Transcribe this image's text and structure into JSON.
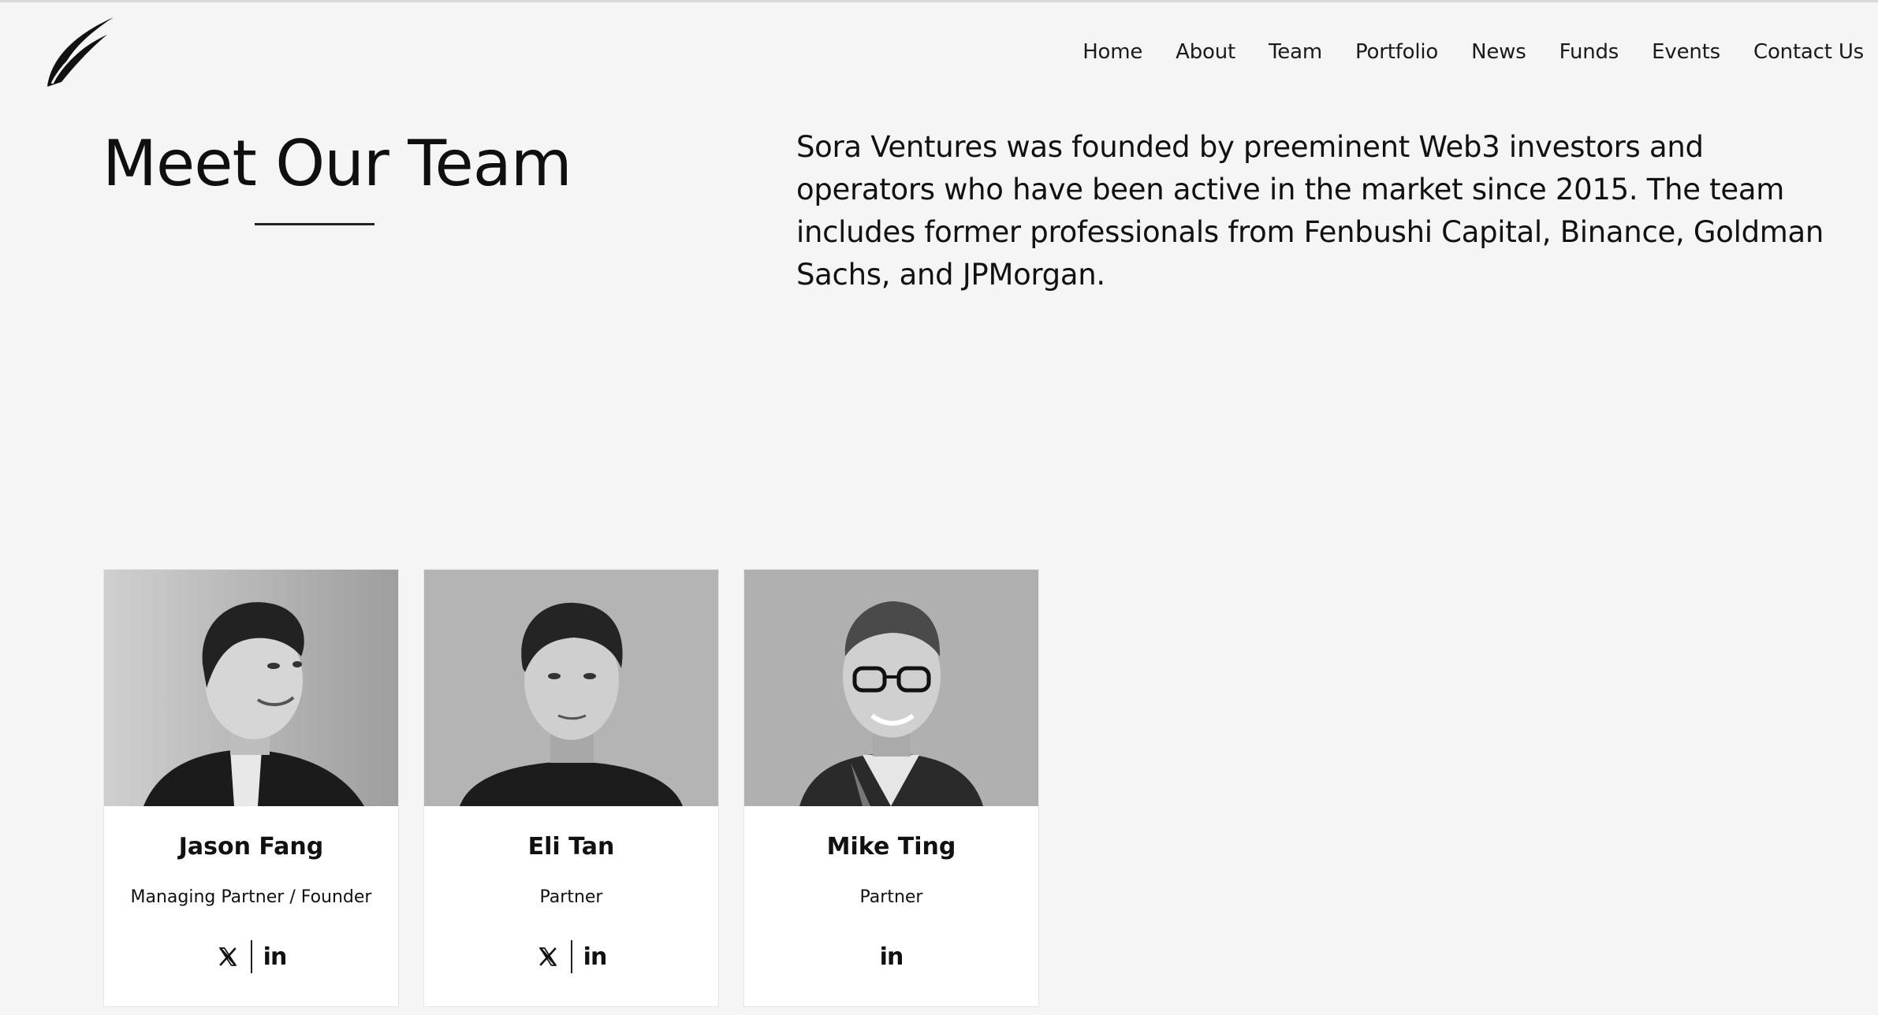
{
  "header": {
    "logo_icon": "feather-logo-icon",
    "nav": [
      {
        "label": "Home"
      },
      {
        "label": "About"
      },
      {
        "label": "Team"
      },
      {
        "label": "Portfolio"
      },
      {
        "label": "News"
      },
      {
        "label": "Funds"
      },
      {
        "label": "Events"
      },
      {
        "label": "Contact Us"
      }
    ]
  },
  "hero": {
    "title": "Meet Our Team",
    "intro": "Sora Ventures was founded by preeminent Web3 investors and operators who have been active in the market since 2015. The team includes former professionals from Fenbushi Capital, Binance, Goldman Sachs, and JPMorgan."
  },
  "team": [
    {
      "name": "Jason Fang",
      "role": "Managing Partner / Founder",
      "socials": [
        "x-icon",
        "linkedin-icon"
      ]
    },
    {
      "name": "Eli Tan",
      "role": "Partner",
      "socials": [
        "x-icon",
        "linkedin-icon"
      ]
    },
    {
      "name": "Mike Ting",
      "role": "Partner",
      "socials": [
        "linkedin-icon"
      ]
    }
  ],
  "colors": {
    "background": "#f5f5f5",
    "card": "#ffffff",
    "text": "#111111"
  }
}
